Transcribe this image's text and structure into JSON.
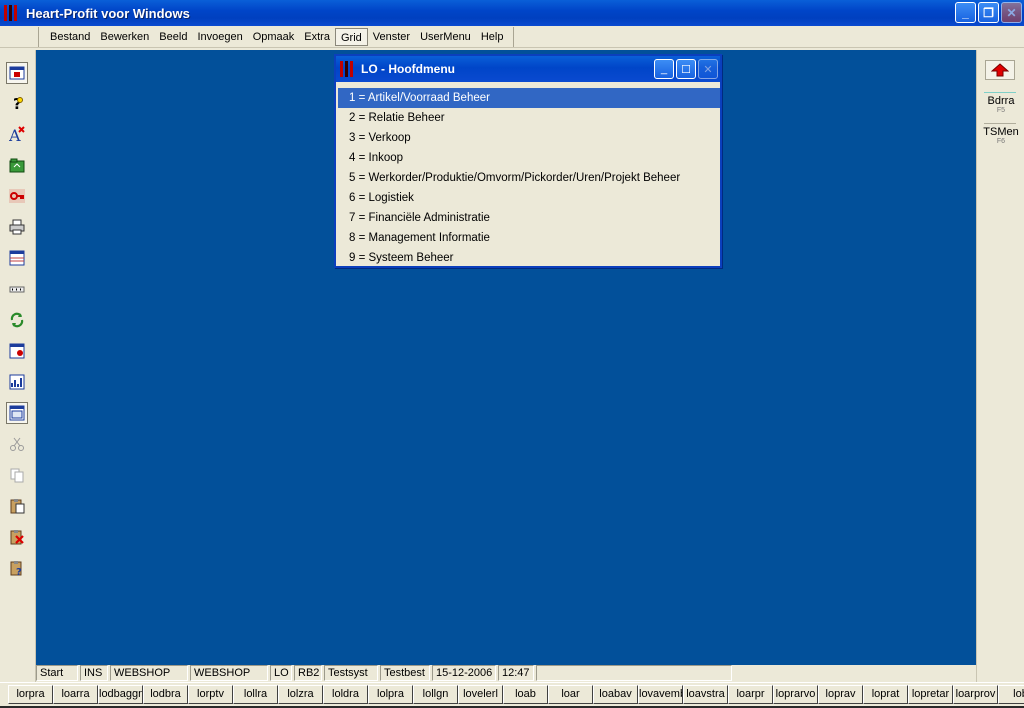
{
  "window": {
    "title": "Heart-Profit voor Windows",
    "controls": {
      "minimize": "_",
      "restore": "❐",
      "close": "✕"
    }
  },
  "menubar": {
    "items": [
      "Bestand",
      "Bewerken",
      "Beeld",
      "Invoegen",
      "Opmaak",
      "Extra",
      "Grid",
      "Venster",
      "UserMenu",
      "Help"
    ],
    "active": "Grid"
  },
  "toolbar": {
    "icons": [
      "window-icon",
      "help-icon",
      "font-icon",
      "open-folder-icon",
      "key-icon",
      "print-icon",
      "grid-window-icon",
      "dots-icon",
      "refresh-icon",
      "record-icon",
      "chart-icon",
      "window-frame-icon",
      "scissors-icon",
      "copy-icon",
      "paste-icon",
      "delete-icon",
      "paste-special-icon"
    ]
  },
  "rightpanel": {
    "buttons": [
      {
        "label": "Bdrra",
        "key": "F5"
      },
      {
        "label": "TSMen",
        "key": "F6"
      }
    ]
  },
  "dialog": {
    "title": "LO - Hoofdmenu",
    "items": [
      "1 = Artikel/Voorraad Beheer",
      "2 = Relatie Beheer",
      "3 = Verkoop",
      "4 = Inkoop",
      "5 = Werkorder/Produktie/Omvorm/Pickorder/Uren/Projekt Beheer",
      "6 = Logistiek",
      "7 = Financiële Administratie",
      "8 = Management Informatie",
      "9 = Systeem Beheer"
    ],
    "selected_index": 0
  },
  "statusbar": {
    "cells": [
      "Start",
      "INS",
      "WEBSHOP",
      "WEBSHOP",
      "LO",
      "RB2",
      "Testsyst",
      "Testbest",
      "15-12-2006",
      "12:47",
      ""
    ]
  },
  "bottombar": {
    "buttons": [
      "lorpra",
      "loarra",
      "lodbaggn",
      "lodbra",
      "lorptv",
      "lollra",
      "lolzra",
      "loldra",
      "lolpra",
      "lollgn",
      "lovelerl",
      "loab",
      "loar",
      "loabav",
      "lovavemb",
      "loavstra",
      "loarpr",
      "loprarvo",
      "loprav",
      "loprat",
      "lopretar",
      "loarprov",
      "lob"
    ]
  },
  "colors": {
    "workspace": "#02509a",
    "titlebar": "#0045c8",
    "selection": "#3167c4",
    "chrome": "#ece9d8"
  }
}
